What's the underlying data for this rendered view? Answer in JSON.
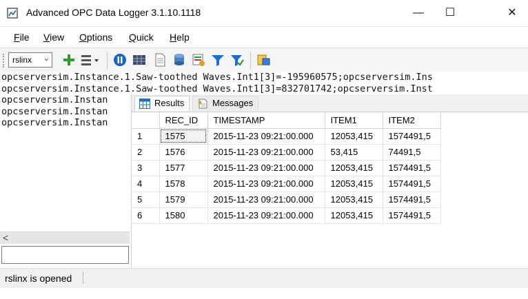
{
  "window": {
    "title": "Advanced OPC Data Logger 3.1.10.1118",
    "minimize_glyph": "—",
    "maximize_glyph": "☐",
    "close_glyph": "✕"
  },
  "menu": {
    "items": [
      {
        "label": "File",
        "mnemonic": "F",
        "rest": "ile"
      },
      {
        "label": "View",
        "mnemonic": "V",
        "rest": "iew"
      },
      {
        "label": "Options",
        "mnemonic": "O",
        "rest": "ptions"
      },
      {
        "label": "Quick",
        "mnemonic": "Q",
        "rest": "uick"
      },
      {
        "label": "Help",
        "mnemonic": "H",
        "rest": "elp"
      }
    ]
  },
  "toolbar": {
    "server_select_value": "rslinx",
    "icons": [
      "add-icon",
      "list-menu-icon",
      "pause-icon",
      "grid-icon",
      "document-icon",
      "database-icon",
      "report-icon",
      "filter-icon",
      "filter-check-icon",
      "export-icon"
    ]
  },
  "log": {
    "lines": [
      "opcserversim.Instance.1.Saw-toothed Waves.Int1[3]=-195960575;opcserversim.Ins",
      "opcserversim.Instance.1.Saw-toothed Waves.Int1[3]=832701742;opcserversim.Inst",
      "opcserversim.Instan",
      "opcserversim.Instan",
      "opcserversim.Instan"
    ]
  },
  "scroll_left_glyph": "<",
  "status": {
    "text": "rslinx is opened"
  },
  "results": {
    "tabs": [
      {
        "label": "Results",
        "active": true
      },
      {
        "label": "Messages",
        "active": false
      }
    ],
    "columns": [
      "",
      "REC_ID",
      "TIMESTAMP",
      "ITEM1",
      "ITEM2"
    ],
    "rows": [
      [
        "1",
        "1575",
        "2015-11-23 09:21:00.000",
        "12053,415",
        "1574491,5"
      ],
      [
        "2",
        "1576",
        "2015-11-23 09:21:00.000",
        "53,415",
        "74491,5"
      ],
      [
        "3",
        "1577",
        "2015-11-23 09:21:00.000",
        "12053,415",
        "1574491,5"
      ],
      [
        "4",
        "1578",
        "2015-11-23 09:21:00.000",
        "12053,415",
        "1574491,5"
      ],
      [
        "5",
        "1579",
        "2015-11-23 09:21:00.000",
        "12053,415",
        "1574491,5"
      ],
      [
        "6",
        "1580",
        "2015-11-23 09:21:00.000",
        "12053,415",
        "1574491,5"
      ]
    ]
  },
  "colors": {
    "accent_blue": "#1565c0",
    "toolbar_bg": "#f4f4f4",
    "green_add": "#2e9b2e"
  }
}
